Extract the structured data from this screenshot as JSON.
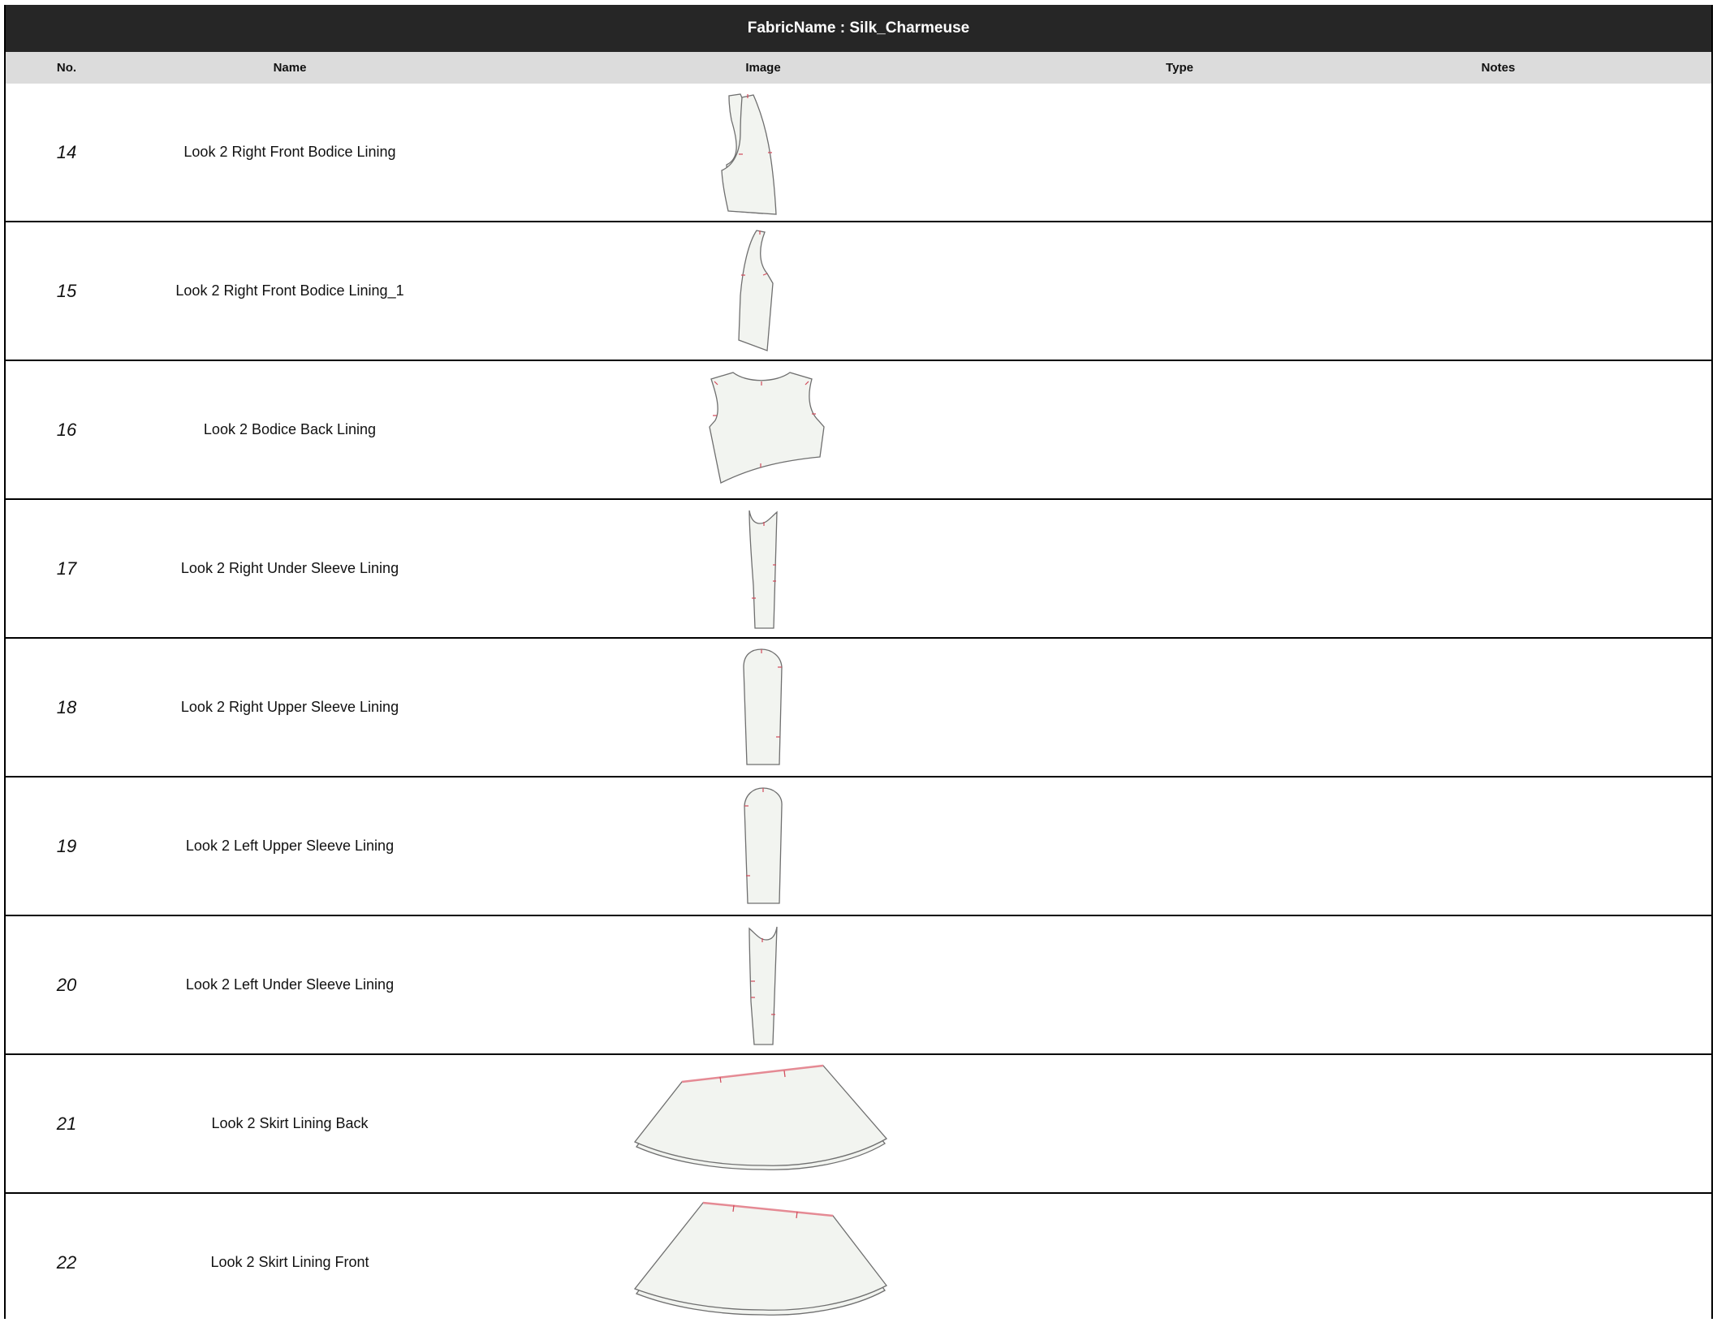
{
  "header": {
    "title": "FabricName : Silk_Charmeuse"
  },
  "columns": {
    "no": "No.",
    "name": "Name",
    "image": "Image",
    "type": "Type",
    "notes": "Notes"
  },
  "rows": [
    {
      "no": "14",
      "name": "Look 2 Right Front Bodice Lining",
      "type": "",
      "notes": "",
      "icon": "bodice-front-piece-icon"
    },
    {
      "no": "15",
      "name": "Look 2 Right Front Bodice Lining_1",
      "type": "",
      "notes": "",
      "icon": "bodice-front-narrow-piece-icon"
    },
    {
      "no": "16",
      "name": "Look 2 Bodice Back Lining",
      "type": "",
      "notes": "",
      "icon": "bodice-back-piece-icon"
    },
    {
      "no": "17",
      "name": "Look 2 Right Under Sleeve Lining",
      "type": "",
      "notes": "",
      "icon": "under-sleeve-piece-icon"
    },
    {
      "no": "18",
      "name": "Look 2 Right Upper Sleeve Lining",
      "type": "",
      "notes": "",
      "icon": "upper-sleeve-piece-icon"
    },
    {
      "no": "19",
      "name": "Look 2 Left Upper Sleeve Lining",
      "type": "",
      "notes": "",
      "icon": "upper-sleeve-piece-icon"
    },
    {
      "no": "20",
      "name": "Look 2 Left Under Sleeve Lining",
      "type": "",
      "notes": "",
      "icon": "under-sleeve-piece-icon"
    },
    {
      "no": "21",
      "name": "Look 2 Skirt Lining Back",
      "type": "",
      "notes": "",
      "icon": "skirt-piece-icon"
    },
    {
      "no": "22",
      "name": "Look 2 Skirt Lining Front",
      "type": "",
      "notes": "",
      "icon": "skirt-piece-icon"
    }
  ]
}
